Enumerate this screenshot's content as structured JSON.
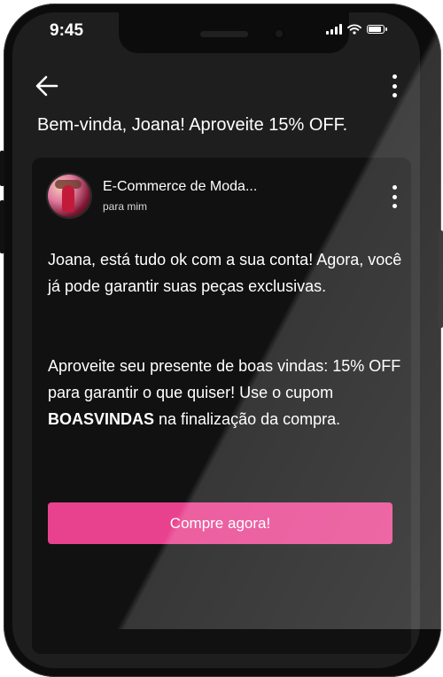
{
  "status_bar": {
    "time": "9:45",
    "icons": [
      "signal-icon",
      "wifi-icon",
      "battery-icon"
    ]
  },
  "toolbar": {
    "back_icon": "arrow-left-icon",
    "menu_icon": "more-vertical-icon"
  },
  "email": {
    "subject": "Bem-vinda, Joana! Aproveite 15% OFF.",
    "sender": "E-Commerce de Moda...",
    "recipient": "para mim",
    "paragraph1": "Joana, está tudo ok com a sua conta! Agora, você já pode garantir suas peças exclusivas.",
    "paragraph2_before": "Aproveite seu presente de boas vindas: 15% OFF para garantir o que quiser! Use o cupom ",
    "coupon_code": "BOASVINDAS",
    "paragraph2_after": " na finalização da compra.",
    "cta_label": "Compre agora!"
  },
  "colors": {
    "background": "#1e1e1f",
    "card": "#111112",
    "accent": "#e8418e",
    "text": "#ffffff"
  }
}
